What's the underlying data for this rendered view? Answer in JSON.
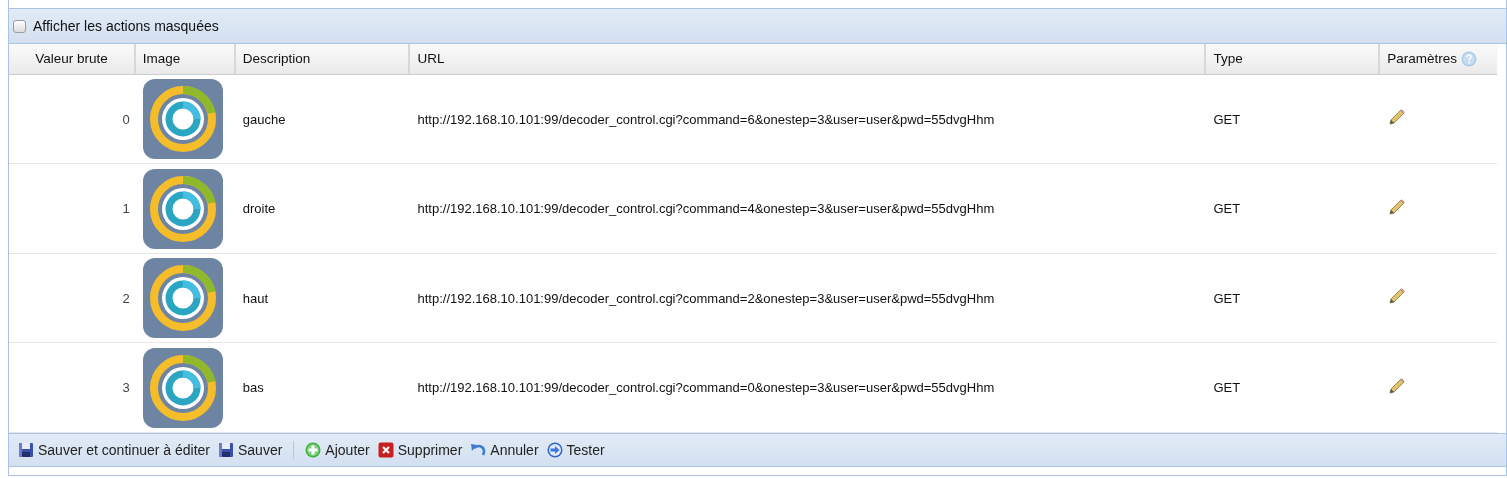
{
  "filter": {
    "label": "Afficher les actions masquées",
    "checked": false
  },
  "table": {
    "columns": [
      {
        "label": "Valeur brute",
        "kind": "value"
      },
      {
        "label": "Image",
        "kind": "image"
      },
      {
        "label": "Description",
        "kind": "text"
      },
      {
        "label": "URL",
        "kind": "text"
      },
      {
        "label": "Type",
        "kind": "text"
      },
      {
        "label": "Paramètres",
        "kind": "params"
      }
    ],
    "rows": [
      {
        "value": "0",
        "description": "gauche",
        "url": "http://192.168.10.101:99/decoder_control.cgi?command=6&onestep=3&user=user&pwd=55dvgHhm",
        "type": "GET"
      },
      {
        "value": "1",
        "description": "droite",
        "url": "http://192.168.10.101:99/decoder_control.cgi?command=4&onestep=3&user=user&pwd=55dvgHhm",
        "type": "GET"
      },
      {
        "value": "2",
        "description": "haut",
        "url": "http://192.168.10.101:99/decoder_control.cgi?command=2&onestep=3&user=user&pwd=55dvgHhm",
        "type": "GET"
      },
      {
        "value": "3",
        "description": "bas",
        "url": "http://192.168.10.101:99/decoder_control.cgi?command=0&onestep=3&user=user&pwd=55dvgHhm",
        "type": "GET"
      }
    ]
  },
  "toolbar": [
    {
      "kind": "save",
      "label": "Sauver et continuer à éditer"
    },
    {
      "kind": "save",
      "label": "Sauver"
    },
    {
      "kind": "separator"
    },
    {
      "kind": "add",
      "label": "Ajouter"
    },
    {
      "kind": "delete",
      "label": "Supprimer"
    },
    {
      "kind": "undo",
      "label": "Annuler"
    },
    {
      "kind": "test",
      "label": "Tester"
    }
  ]
}
